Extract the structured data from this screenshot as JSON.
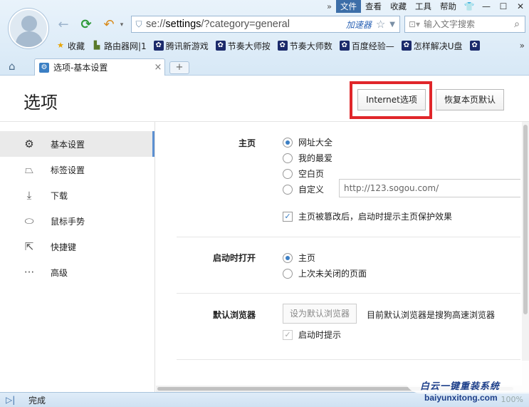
{
  "menubar": {
    "more": "»",
    "items": [
      "文件",
      "查看",
      "收藏",
      "工具",
      "帮助"
    ],
    "window_controls": [
      "👕",
      "—",
      "☐",
      "✕"
    ]
  },
  "address": {
    "prefix": "se://",
    "host": "settings",
    "path": "/?category=general",
    "accelerator": "加速器"
  },
  "search": {
    "placeholder": "输入文字搜索"
  },
  "bookmarks": {
    "items": [
      "收藏",
      "路由器网|1",
      "腾讯新游戏",
      "节奏大师按",
      "节奏大师数",
      "百度经验—",
      "怎样解决U盘"
    ],
    "more": "»"
  },
  "tab": {
    "title": "选项-基本设置",
    "close": "×",
    "new": "+"
  },
  "page": {
    "title": "选项",
    "internet_options": "Internet选项",
    "restore_defaults": "恢复本页默认"
  },
  "sidebar": {
    "items": [
      {
        "label": "基本设置",
        "icon": "⚙"
      },
      {
        "label": "标签设置",
        "icon": "⏢"
      },
      {
        "label": "下载",
        "icon": "⤓"
      },
      {
        "label": "鼠标手势",
        "icon": "⬭"
      },
      {
        "label": "快捷键",
        "icon": "⇱"
      },
      {
        "label": "高级",
        "icon": "···"
      }
    ]
  },
  "homepage": {
    "label": "主页",
    "options": [
      "网址大全",
      "我的最爱",
      "空白页",
      "自定义"
    ],
    "selected": 0,
    "custom_url": "http://123.sogou.com/",
    "protect_label": "主页被篡改后，启动时提示主页保护效果"
  },
  "startup": {
    "label": "启动时打开",
    "options": [
      "主页",
      "上次未关闭的页面"
    ],
    "selected": 0
  },
  "default_browser": {
    "label": "默认浏览器",
    "button": "设为默认浏览器",
    "note": "目前默认浏览器是搜狗高速浏览器",
    "check_label": "启动时提示"
  },
  "status": {
    "text": "完成",
    "zoom": "100%"
  },
  "watermark": {
    "line1": "白云一键重装系统",
    "line2": "baiyunxitong.com"
  }
}
